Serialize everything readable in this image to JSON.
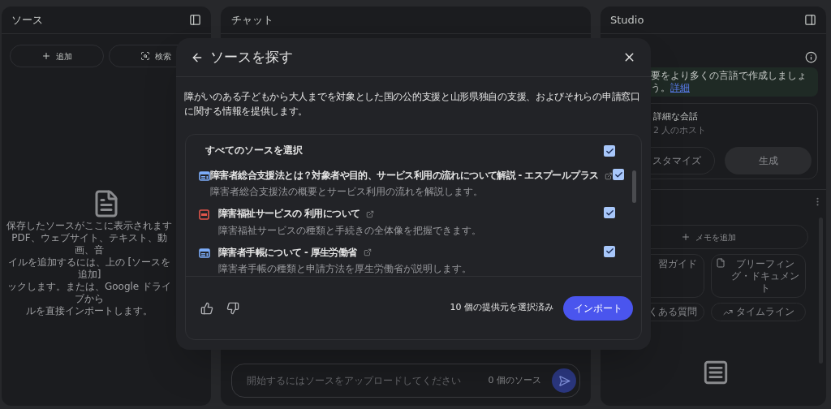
{
  "sources_panel": {
    "title": "ソース",
    "buttons": [
      {
        "kind": "add",
        "label": "追加"
      },
      {
        "kind": "search",
        "label": "検索"
      }
    ],
    "empty_lines": [
      "保存したソースがここに表示されます",
      "PDF、ウェブサイト、テキスト、動画、音",
      "イルを追加するには、上の [ソースを追加]",
      "ックします。または、Google ドライブから",
      "ルを直接インポートします。"
    ]
  },
  "chat_panel": {
    "title": "チャット",
    "input_placeholder": "開始するにはソースをアップロードしてください",
    "source_count": "0 個のソース"
  },
  "studio_panel": {
    "title": "Studio",
    "banner_text": "要をより多くの言語で作成しましょう。",
    "banner_link": "詳細",
    "card_title": "詳細な会話",
    "card_subtitle": "2 人のホスト",
    "card_buttons": [
      "スタマイズ",
      "生成"
    ],
    "add_note": "メモを追加",
    "note_buttons": [
      {
        "kind": "cut",
        "label": "習ガイド"
      },
      {
        "kind": "doc",
        "label": "ブリーフィング・ドキュメント"
      },
      {
        "kind": "cut",
        "label": "くある質問"
      },
      {
        "kind": "timeline",
        "label": "タイムライン"
      }
    ]
  },
  "dialog": {
    "title": "ソースを探す",
    "description": "障がいのある子どもから大人までを対象とした国の公的支援と山形県独自の支援、およびそれらの申請窓口に関する情報を提供します。",
    "select_all": {
      "label": "すべてのソースを選択",
      "checked": true
    },
    "items": [
      {
        "kind": "web",
        "title": "障害者総合支援法とは？対象者や目的、サービス利用の流れについて解説 - エスプールプラス",
        "summary": "障害者総合支援法の概要とサービス利用の流れを解説します。",
        "checked": true
      },
      {
        "kind": "pdf",
        "title": "障害福祉サービスの 利用について",
        "summary": "障害福祉サービスの種類と手続きの全体像を把握できます。",
        "checked": true
      },
      {
        "kind": "web",
        "title": "障害者手帳について - 厚生労働省",
        "summary": "障害者手帳の種類と申請方法を厚生労働省が説明します。",
        "checked": true
      }
    ],
    "selected_count": "10 個の提供元を選択済み",
    "import_button": "インポート"
  }
}
